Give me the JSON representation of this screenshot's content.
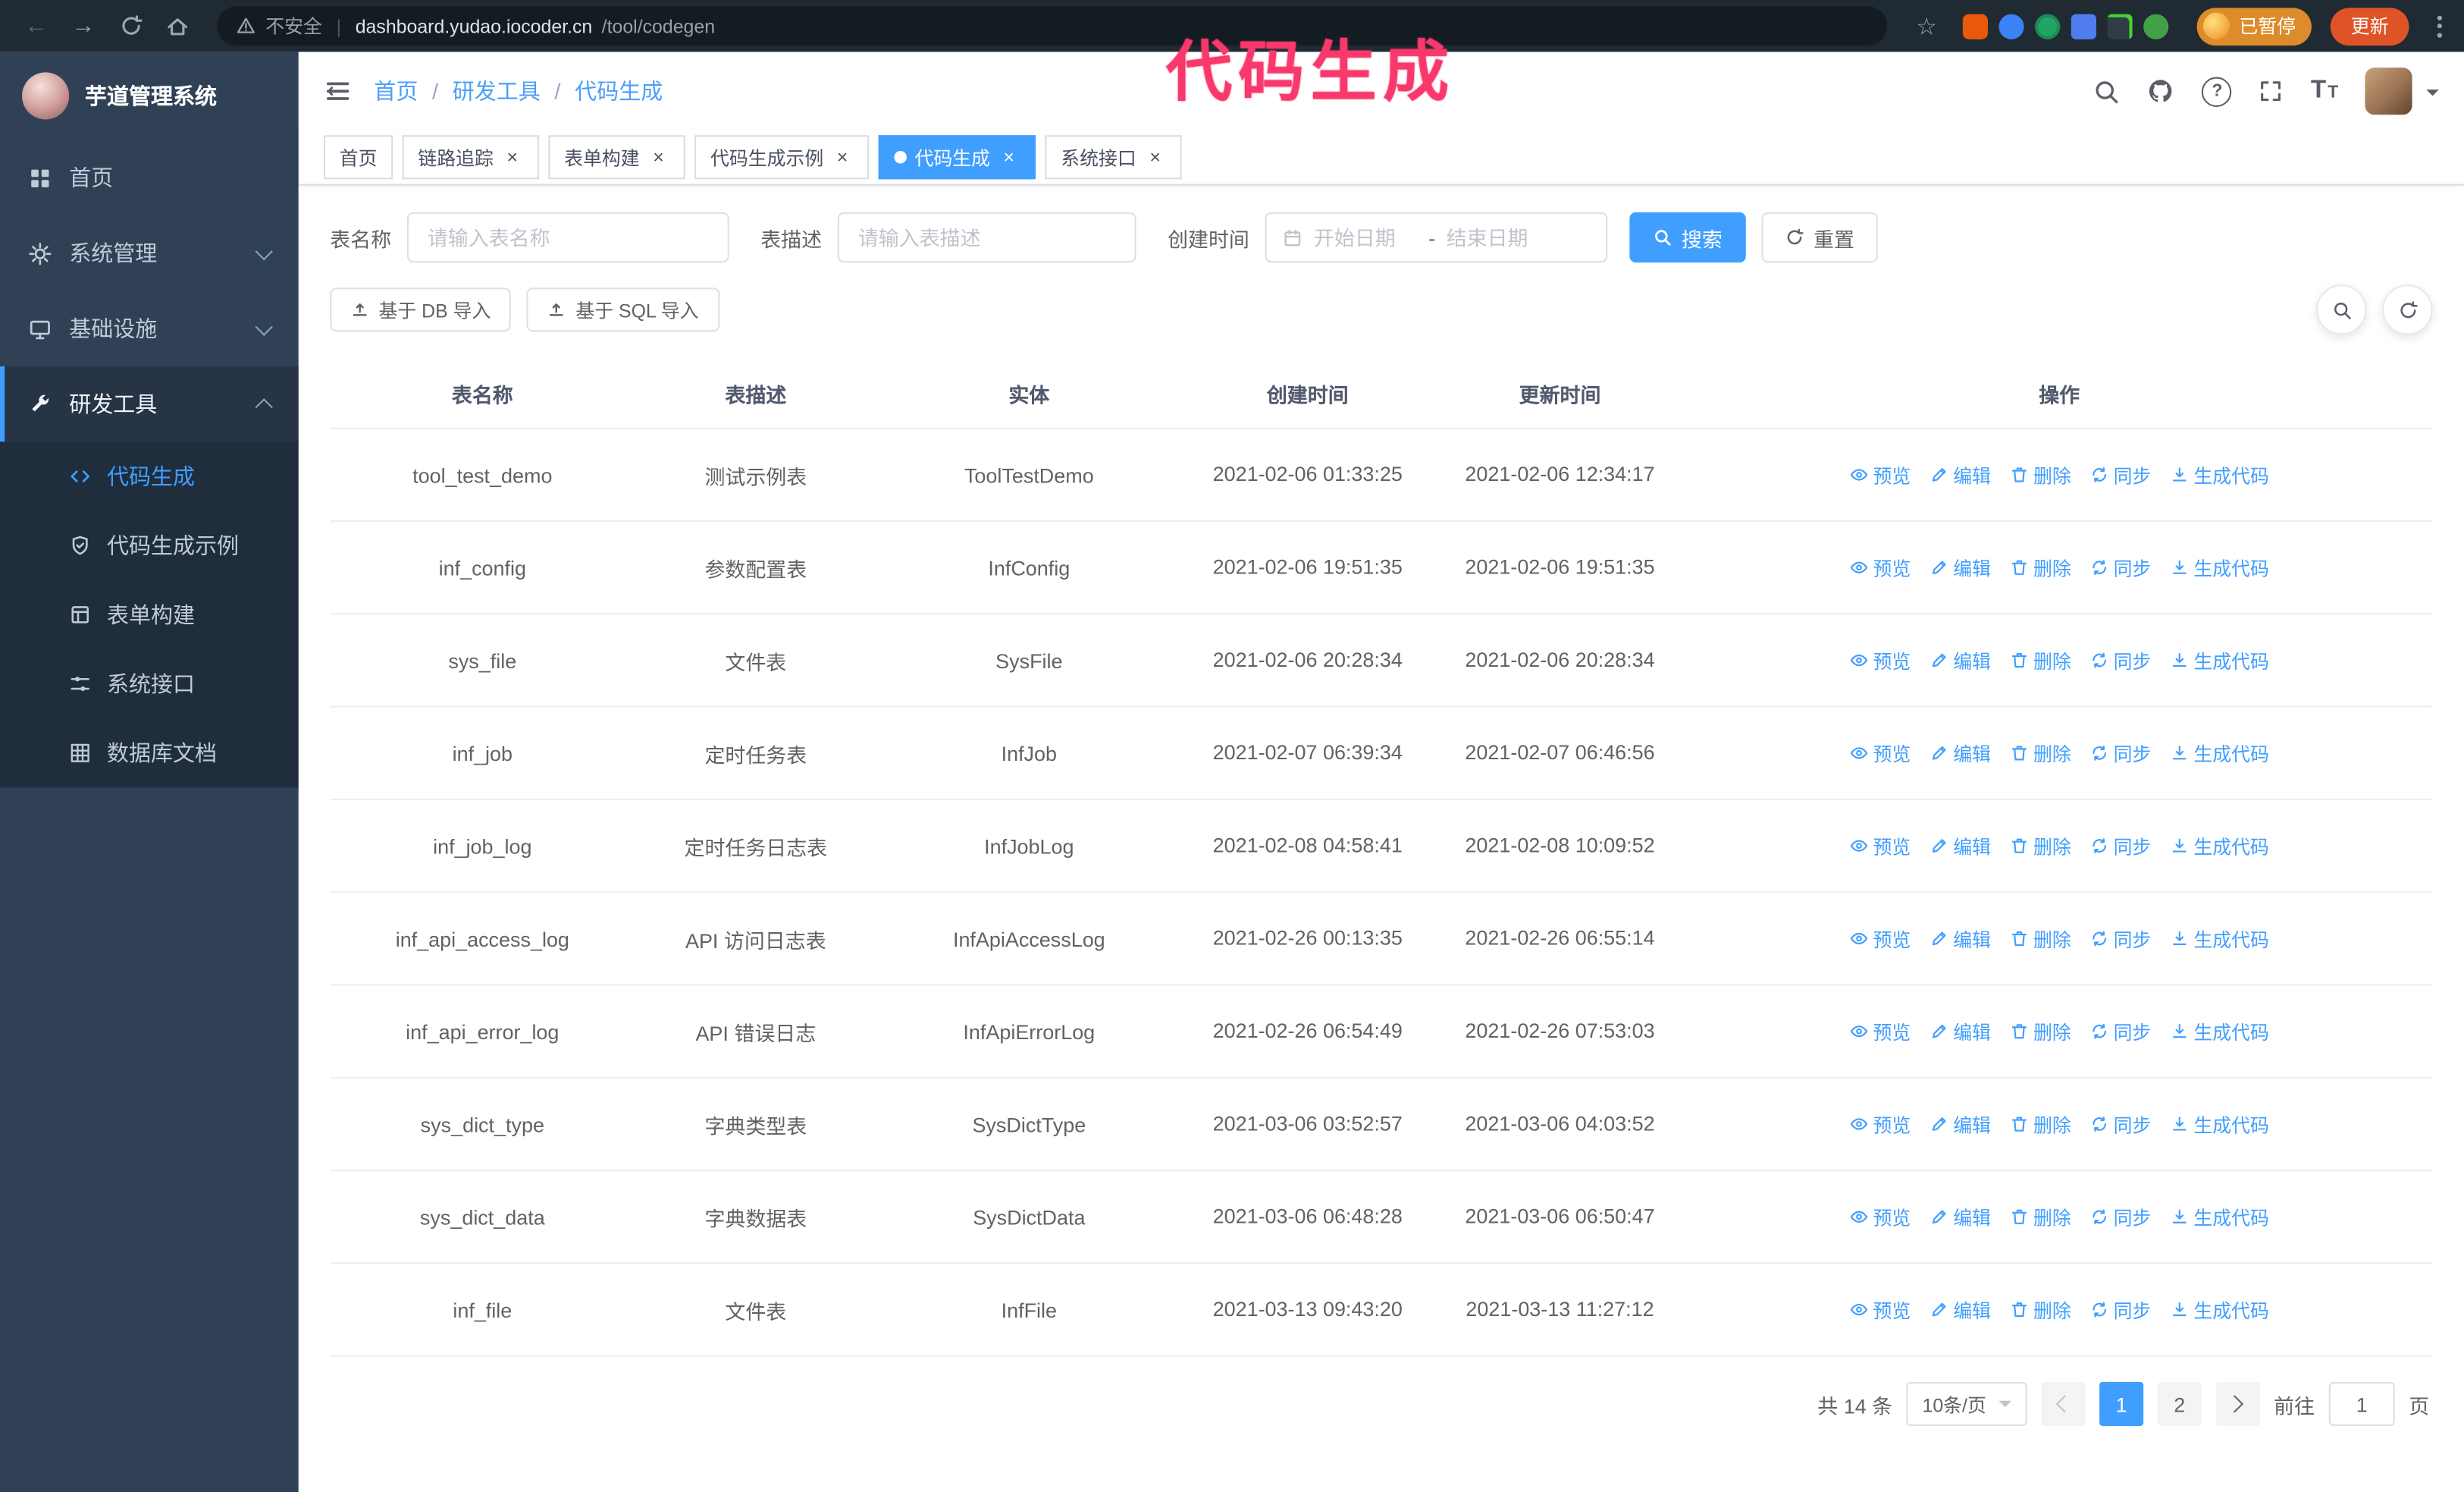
{
  "annotation": {
    "text": "代码生成",
    "color": "#f9386b"
  },
  "browser": {
    "security_label": "不安全",
    "url_divider": "|",
    "host": "dashboard.yudao.iocoder.cn",
    "path": "/tool/codegen",
    "profile_chip_label": "已暂停",
    "update_button_label": "更新"
  },
  "icons": {
    "close": "×",
    "star": "☆",
    "question": "?",
    "back_arrow": "←",
    "forward_arrow": "→",
    "font_large": "T",
    "font_small": "T"
  },
  "sidebar": {
    "logo_title": "芋道管理系统",
    "items": [
      {
        "label": "首页"
      },
      {
        "label": "系统管理"
      },
      {
        "label": "基础设施"
      },
      {
        "label": "研发工具"
      }
    ],
    "submenu": [
      {
        "label": "代码生成"
      },
      {
        "label": "代码生成示例"
      },
      {
        "label": "表单构建"
      },
      {
        "label": "系统接口"
      },
      {
        "label": "数据库文档"
      }
    ]
  },
  "header": {
    "breadcrumb": [
      "首页",
      "研发工具",
      "代码生成"
    ],
    "separator": "/"
  },
  "tabs": {
    "items": [
      "首页",
      "链路追踪",
      "表单构建",
      "代码生成示例",
      "代码生成",
      "系统接口"
    ]
  },
  "filters": {
    "table_name_label": "表名称",
    "table_name_placeholder": "请输入表名称",
    "table_desc_label": "表描述",
    "table_desc_placeholder": "请输入表描述",
    "create_time_label": "创建时间",
    "date_start_placeholder": "开始日期",
    "date_separator": "-",
    "date_end_placeholder": "结束日期",
    "search_button": "搜索",
    "reset_button": "重置"
  },
  "toolbar": {
    "import_db_button": "基于 DB 导入",
    "import_sql_button": "基于 SQL 导入"
  },
  "table": {
    "columns": [
      "表名称",
      "表描述",
      "实体",
      "创建时间",
      "更新时间",
      "操作"
    ],
    "action_labels": [
      "预览",
      "编辑",
      "删除",
      "同步",
      "生成代码"
    ],
    "rows": [
      {
        "name": "tool_test_demo",
        "desc": "测试示例表",
        "entity": "ToolTestDemo",
        "created": "2021-02-06 01:33:25",
        "updated": "2021-02-06 12:34:17"
      },
      {
        "name": "inf_config",
        "desc": "参数配置表",
        "entity": "InfConfig",
        "created": "2021-02-06 19:51:35",
        "updated": "2021-02-06 19:51:35"
      },
      {
        "name": "sys_file",
        "desc": "文件表",
        "entity": "SysFile",
        "created": "2021-02-06 20:28:34",
        "updated": "2021-02-06 20:28:34"
      },
      {
        "name": "inf_job",
        "desc": "定时任务表",
        "entity": "InfJob",
        "created": "2021-02-07 06:39:34",
        "updated": "2021-02-07 06:46:56"
      },
      {
        "name": "inf_job_log",
        "desc": "定时任务日志表",
        "entity": "InfJobLog",
        "created": "2021-02-08 04:58:41",
        "updated": "2021-02-08 10:09:52"
      },
      {
        "name": "inf_api_access_log",
        "desc": "API 访问日志表",
        "entity": "InfApiAccessLog",
        "created": "2021-02-26 00:13:35",
        "updated": "2021-02-26 06:55:14"
      },
      {
        "name": "inf_api_error_log",
        "desc": "API 错误日志",
        "entity": "InfApiErrorLog",
        "created": "2021-02-26 06:54:49",
        "updated": "2021-02-26 07:53:03"
      },
      {
        "name": "sys_dict_type",
        "desc": "字典类型表",
        "entity": "SysDictType",
        "created": "2021-03-06 03:52:57",
        "updated": "2021-03-06 04:03:52"
      },
      {
        "name": "sys_dict_data",
        "desc": "字典数据表",
        "entity": "SysDictData",
        "created": "2021-03-06 06:48:28",
        "updated": "2021-03-06 06:50:47"
      },
      {
        "name": "inf_file",
        "desc": "文件表",
        "entity": "InfFile",
        "created": "2021-03-13 09:43:20",
        "updated": "2021-03-13 11:27:12"
      }
    ]
  },
  "pagination": {
    "total": "共 14 条",
    "page_size": "10条/页",
    "page_1": "1",
    "page_2": "2",
    "goto_label": "前往",
    "goto_value": "1",
    "unit_label": "页"
  },
  "colors": {
    "accent": "#409eff",
    "sidebar_bg": "#304156",
    "submenu_bg": "#1f2d3d",
    "annotation": "#f9386b"
  }
}
